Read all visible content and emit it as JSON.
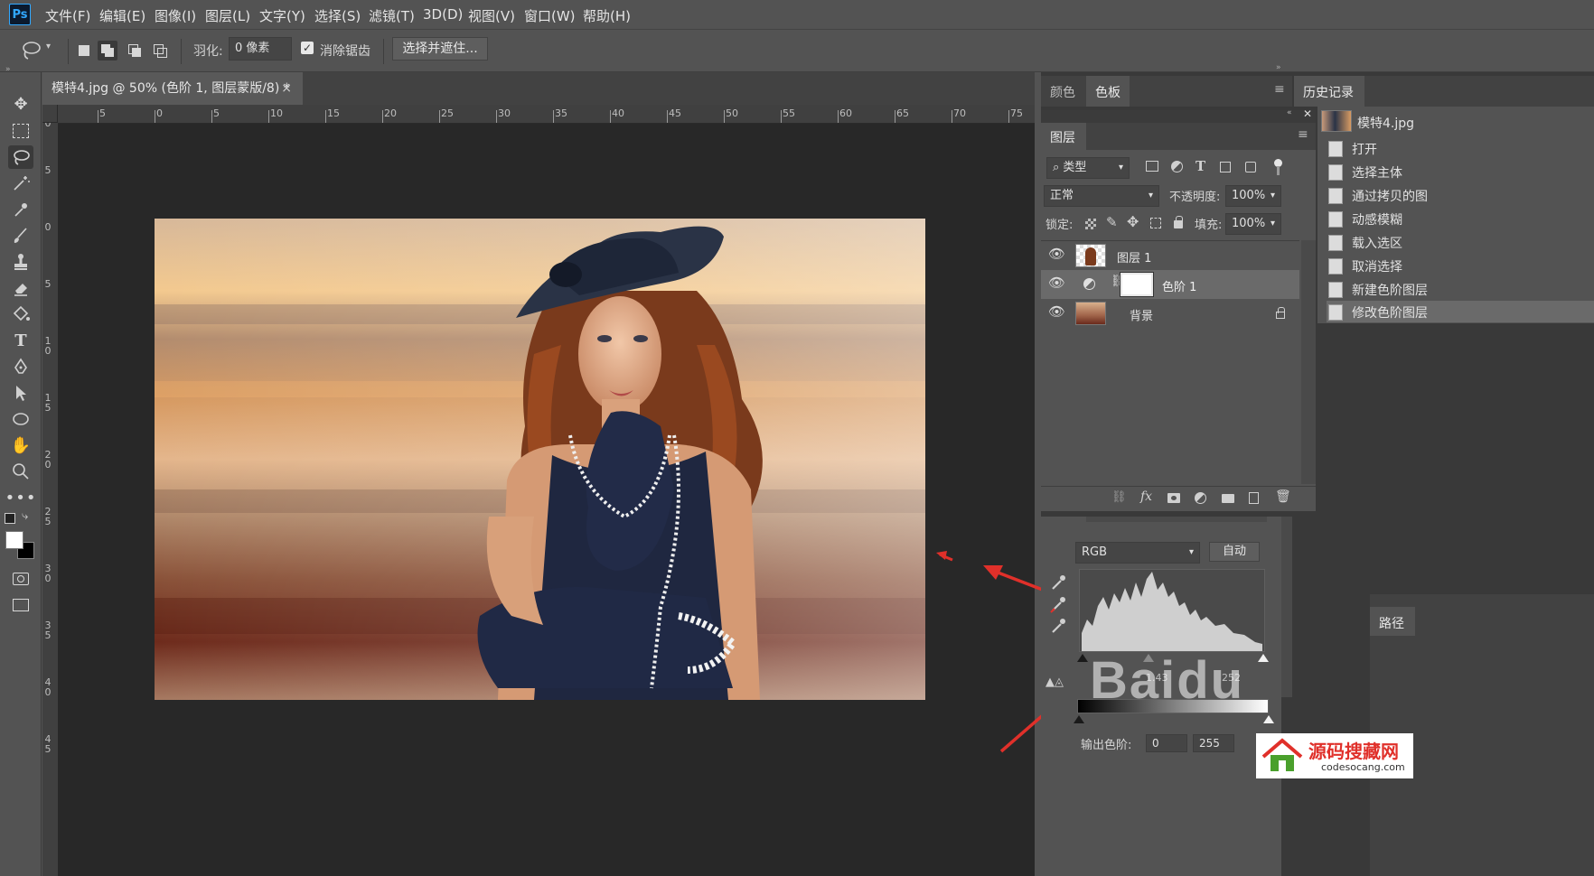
{
  "menubar": {
    "logo": "Ps",
    "items": [
      "文件(F)",
      "编辑(E)",
      "图像(I)",
      "图层(L)",
      "文字(Y)",
      "选择(S)",
      "滤镜(T)",
      "3D(D)",
      "视图(V)",
      "窗口(W)",
      "帮助(H)"
    ]
  },
  "options": {
    "feather_label": "羽化:",
    "feather_value": "0 像素",
    "antialias_label": "消除锯齿",
    "antialias_checked": true,
    "select_mask_button": "选择并遮住..."
  },
  "document": {
    "tab_title": "模特4.jpg @ 50% (色阶 1, 图层蒙版/8) *",
    "close_glyph": "×"
  },
  "ruler": {
    "h_ticks": [
      "5",
      "0",
      "5",
      "10",
      "15",
      "20",
      "25",
      "30",
      "35",
      "40",
      "45",
      "50",
      "55",
      "60",
      "65",
      "70",
      "75"
    ],
    "v_ticks": [
      "1 0",
      "5",
      "0",
      "5",
      "1 0",
      "1 5",
      "2 0",
      "2 5",
      "3 0",
      "3 5",
      "4 0",
      "4 5"
    ]
  },
  "swatch_panel": {
    "tabs": [
      "颜色",
      "色板"
    ]
  },
  "layers_panel": {
    "tab": "图层",
    "filter_label": "类型",
    "blend_mode": "正常",
    "opacity_label": "不透明度:",
    "opacity_value": "100%",
    "lock_label": "锁定:",
    "fill_label": "填充:",
    "fill_value": "100%",
    "layers": [
      {
        "name": "图层 1"
      },
      {
        "name": "色阶 1"
      },
      {
        "name": "背景"
      }
    ]
  },
  "history_panel": {
    "tab": "历史记录",
    "snapshot": "模特4.jpg",
    "items": [
      "打开",
      "选择主体",
      "通过拷贝的图",
      "动感模糊",
      "载入选区",
      "取消选择",
      "新建色阶图层",
      "修改色阶图层"
    ]
  },
  "levels": {
    "channel": "RGB",
    "auto_button": "自动",
    "input_mid": "1.43",
    "input_high": "252",
    "output_label": "输出色阶:",
    "output_low": "0",
    "output_high": "255"
  },
  "paths_panel": {
    "tab": "路径"
  },
  "watermark": {
    "brand": "源码搜藏网",
    "url": "codesocang.com",
    "baidu": "Baidu"
  },
  "colors": {
    "accent_red": "#e0302a",
    "panel": "#535353",
    "canvas": "#282828"
  }
}
